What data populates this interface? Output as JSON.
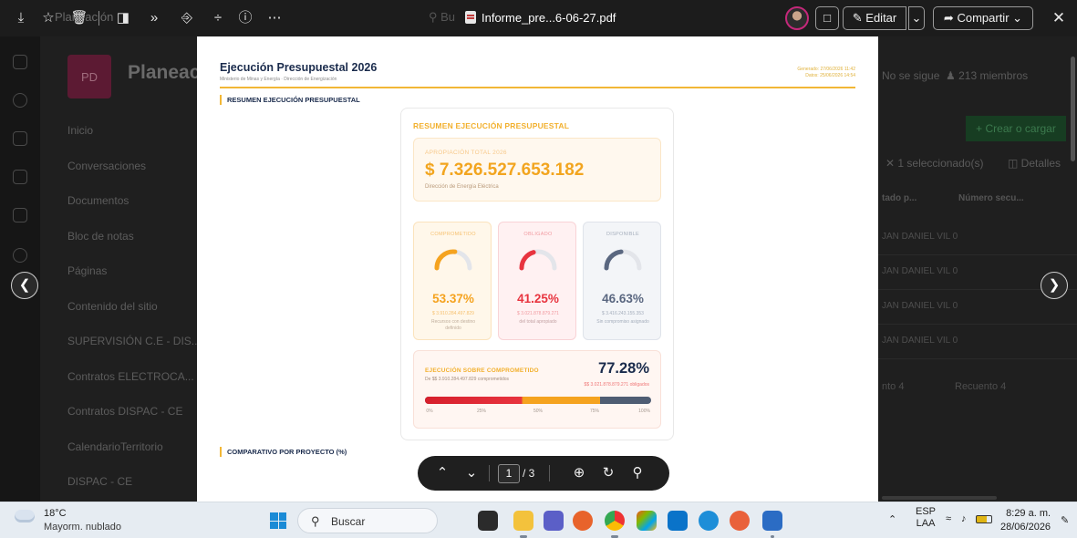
{
  "topbar": {
    "faded_label": "Planeación",
    "filename": "Informe_pre...6-06-27.pdf",
    "search_hint": "Bu",
    "edit_label": "Editar",
    "share_label": "Compartir",
    "icons": [
      "download-icon",
      "favorite-star-icon",
      "delete-icon",
      "copy-link-icon",
      "more-chevrons-icon",
      "share-icon",
      "pin-icon",
      "info-icon",
      "more-dots-icon"
    ]
  },
  "background_site": {
    "logo_text": "PD",
    "title": "Planeación",
    "nav": [
      "Inicio",
      "Conversaciones",
      "Documentos",
      "Bloc de notas",
      "Páginas",
      "Contenido del sitio",
      "SUPERVISIÓN C.E - DIS...",
      "Contratos ELECTROCA...",
      "Contratos DISPAC - CE",
      "CalendarioTerritorio",
      "DISPAC - CE"
    ],
    "follow_label": "No se sigue",
    "members_label": "213 miembros",
    "create_label": "+ Crear o cargar",
    "selection_label": "1 seleccionado(s)",
    "details_label": "Detalles",
    "col1": "tado p...",
    "col2": "Número secu...",
    "rows": [
      "JAN DANIEL VIL 0",
      "JAN DANIEL VIL 0",
      "JAN DANIEL VIL 0",
      "JAN DANIEL VIL 0"
    ],
    "count_a": "nto 4",
    "count_b": "Recuento 4"
  },
  "document": {
    "title": "Ejecución Presupuestal 2026",
    "subtitle": "Ministerio de Minas y Energía · Dirección de Energización",
    "generated": "Generado: 27/06/2026 11:42",
    "data_date": "Datos: 25/06/2026 14:54",
    "section1": "RESUMEN EJECUCIÓN PRESUPUESTAL",
    "section2": "COMPARATIVO POR PROYECTO (%)",
    "dashboard": {
      "title": "RESUMEN EJECUCIÓN PRESUPUESTAL",
      "total_label": "APROPIACIÓN TOTAL 2026",
      "total_amount": "$ 7.326.527.653.182",
      "total_dir": "Dirección de Energía Eléctrica",
      "cards": [
        {
          "label": "COMPROMETIDO",
          "pct": "53.37%",
          "fraction": 0.5337,
          "amount": "$ 3.910.284.497.829",
          "note": "Recursos con destino definido",
          "color": "#f5a31f",
          "bg": "#fff7ea",
          "border": "#fbe3bd",
          "label_color": "#f6c170",
          "pct_color": "#f5a31f",
          "amt_color": "#f6c170",
          "note_color": "#bfae9c"
        },
        {
          "label": "OBLIGADO",
          "pct": "41.25%",
          "fraction": 0.4125,
          "amount": "$ 3.021.878.879.271",
          "note": "del total apropiado",
          "color": "#e8343f",
          "bg": "#fff1f2",
          "border": "#f9d3d6",
          "label_color": "#f19aa0",
          "pct_color": "#e8343f",
          "amt_color": "#f19aa0",
          "note_color": "#c3a2a4"
        },
        {
          "label": "DISPONIBLE",
          "pct": "46.63%",
          "fraction": 0.4663,
          "amount": "$ 3.416.243.155.353",
          "note": "Sin compromiso asignado",
          "color": "#5a6780",
          "bg": "#f3f5f8",
          "border": "#dfe3ea",
          "label_color": "#a5aebc",
          "pct_color": "#5a6780",
          "amt_color": "#a5aebc",
          "note_color": "#a5aebc"
        }
      ],
      "exec_label": "EJECUCIÓN SOBRE COMPROMETIDO",
      "exec_sub": "De $$ 3.910.284.497.829 comprometidos",
      "exec_pct": "77.28%",
      "exec_fraction": 0.7728,
      "exec_amount": "$$ 3.021.878.879.271 obligados",
      "ticks": [
        "0%",
        "25%",
        "50%",
        "75%",
        "100%"
      ]
    }
  },
  "pagebar": {
    "current_page": "1",
    "total_pages": "/ 3"
  },
  "taskbar": {
    "temperature": "18°C",
    "condition": "Mayorm. nublado",
    "search_label": "Buscar",
    "lang": "ESP",
    "layout": "LAA",
    "time": "8:29 a. m.",
    "date": "28/06/2026"
  }
}
